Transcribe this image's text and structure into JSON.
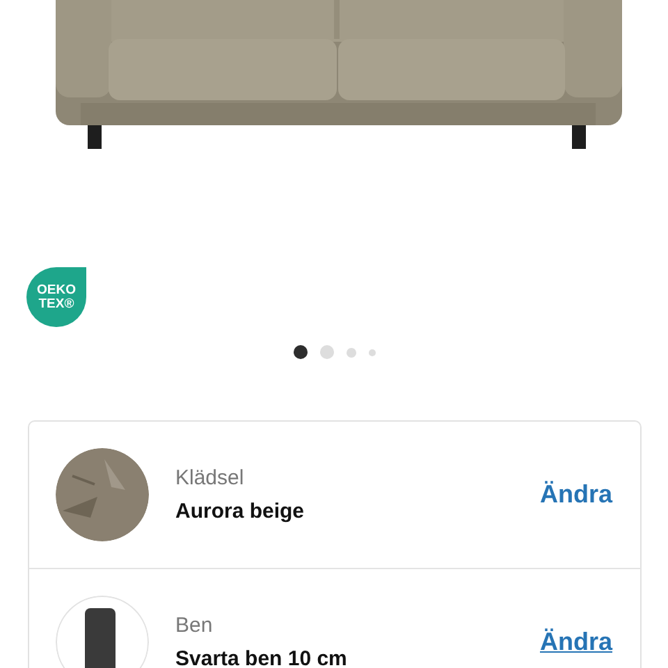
{
  "badge": {
    "lines": [
      "OEKO",
      "TEX®"
    ]
  },
  "carousel": {
    "dots": [
      {
        "selected": true
      },
      {
        "selected": false
      },
      {
        "selected": false
      },
      {
        "selected": false
      }
    ]
  },
  "options": [
    {
      "kind": "fabric",
      "label": "Klädsel",
      "value": "Aurora beige",
      "action": "Ändra",
      "underlined": false
    },
    {
      "kind": "leg",
      "label": "Ben",
      "value": "Svarta ben 10 cm",
      "action": "Ändra",
      "underlined": true
    }
  ]
}
